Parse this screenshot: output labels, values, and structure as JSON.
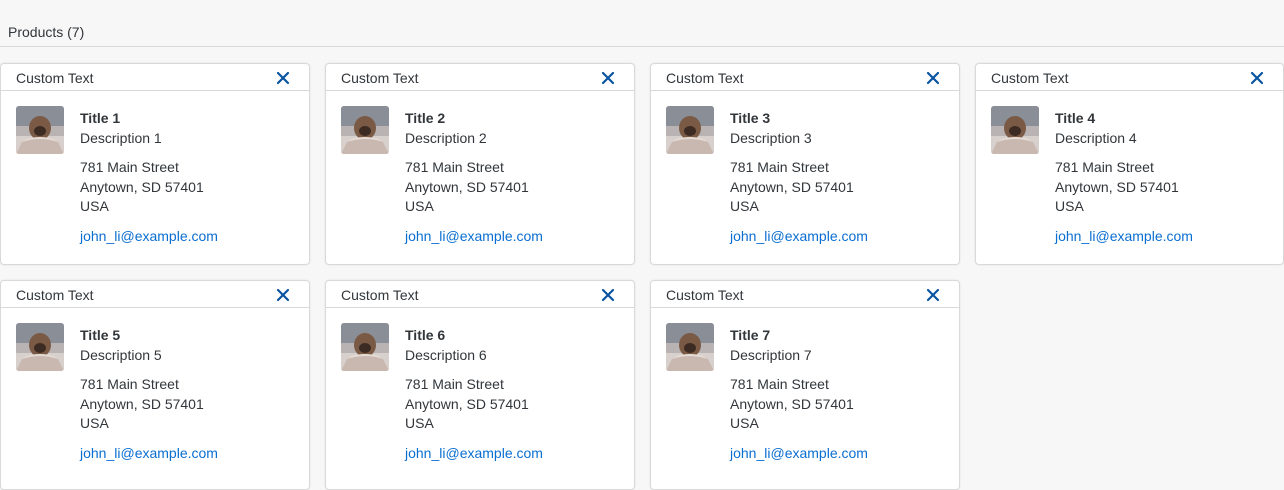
{
  "toolbar": {
    "title": "Products (7)"
  },
  "colors": {
    "link": "#0a6ed1",
    "close_icon": "#0854a0",
    "border": "#d9d9d9"
  },
  "cards": [
    {
      "header": "Custom Text",
      "title": "Title 1",
      "description": "Description 1",
      "street": "781 Main Street",
      "city": "Anytown, SD 57401",
      "country": "USA",
      "email": "john_li@example.com"
    },
    {
      "header": "Custom Text",
      "title": "Title 2",
      "description": "Description 2",
      "street": "781 Main Street",
      "city": "Anytown, SD 57401",
      "country": "USA",
      "email": "john_li@example.com"
    },
    {
      "header": "Custom Text",
      "title": "Title 3",
      "description": "Description 3",
      "street": "781 Main Street",
      "city": "Anytown, SD 57401",
      "country": "USA",
      "email": "john_li@example.com"
    },
    {
      "header": "Custom Text",
      "title": "Title 4",
      "description": "Description 4",
      "street": "781 Main Street",
      "city": "Anytown, SD 57401",
      "country": "USA",
      "email": "john_li@example.com"
    },
    {
      "header": "Custom Text",
      "title": "Title 5",
      "description": "Description 5",
      "street": "781 Main Street",
      "city": "Anytown, SD 57401",
      "country": "USA",
      "email": "john_li@example.com"
    },
    {
      "header": "Custom Text",
      "title": "Title 6",
      "description": "Description 6",
      "street": "781 Main Street",
      "city": "Anytown, SD 57401",
      "country": "USA",
      "email": "john_li@example.com"
    },
    {
      "header": "Custom Text",
      "title": "Title 7",
      "description": "Description 7",
      "street": "781 Main Street",
      "city": "Anytown, SD 57401",
      "country": "USA",
      "email": "john_li@example.com"
    }
  ]
}
